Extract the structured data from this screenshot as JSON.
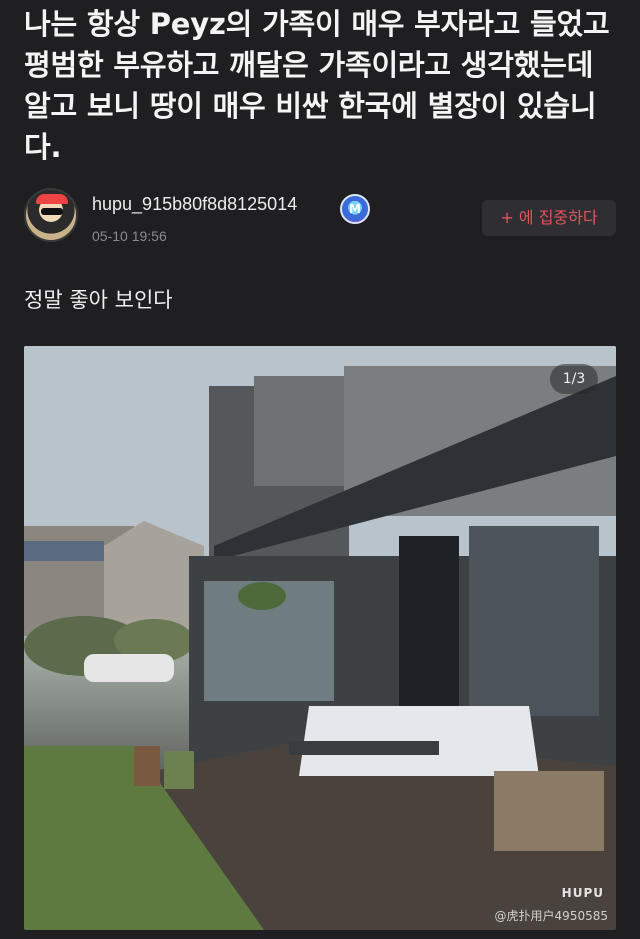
{
  "post": {
    "title": "나는 항상 Peyz의 가족이 매우 부자라고 들었고 평범한 부유하고 깨달은 가족이라고 생각했는데 알고 보니 땅이 매우 비싼 한국에 별장이 있습니다."
  },
  "author": {
    "username": "hupu_915b80f8d8125014",
    "timestamp": "05-10 19:56",
    "badge_text": "M",
    "follow_label": "+ 에 집중하다"
  },
  "comment": {
    "text": "정말 좋아 보인다"
  },
  "image": {
    "counter": "1/3",
    "hupu_watermark": "HUPU",
    "source_watermark": "@虎扑用户4950585"
  },
  "colors": {
    "background": "#1f1f21",
    "follow_text": "#e0555a",
    "follow_bg": "#2f2f33"
  }
}
